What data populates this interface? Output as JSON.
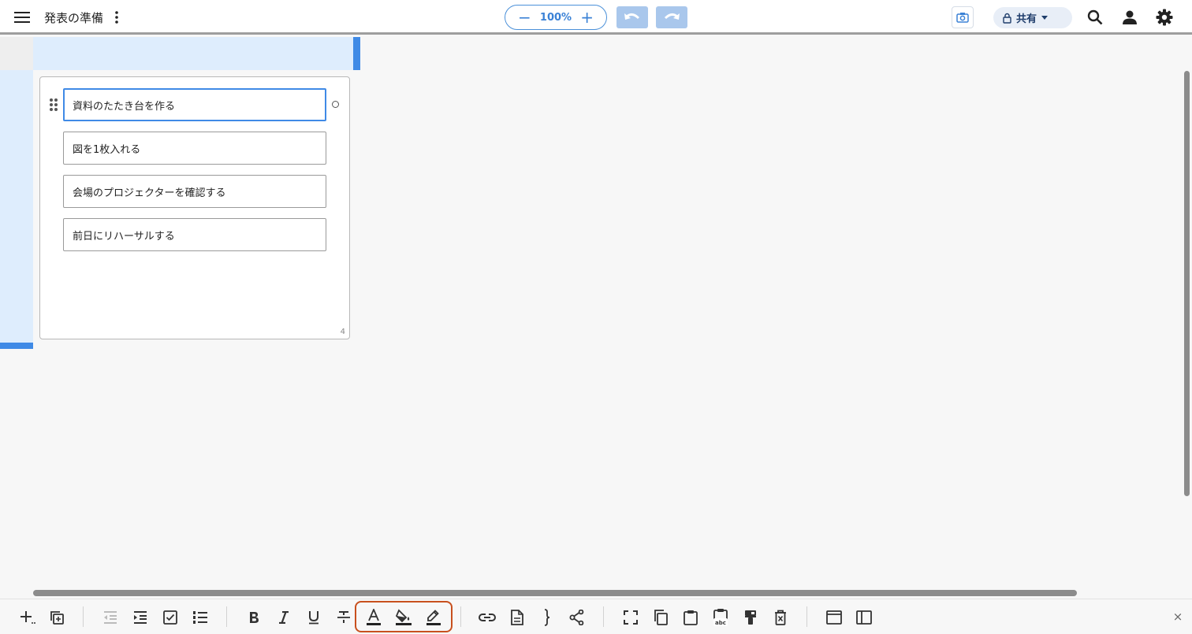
{
  "header": {
    "doc_title": "発表の準備",
    "zoom": {
      "minus": "−",
      "value": "100%",
      "plus": "+"
    },
    "share_label": "共有"
  },
  "card": {
    "items": [
      {
        "text": "資料のたたき台を作る",
        "selected": true
      },
      {
        "text": "図を1枚入れる",
        "selected": false
      },
      {
        "text": "会場のプロジェクターを確認する",
        "selected": false
      },
      {
        "text": "前日にリハーサルする",
        "selected": false
      }
    ],
    "count": "4"
  },
  "toolbar": {
    "tools": [
      "add",
      "duplicate",
      "outdent",
      "indent",
      "checkbox",
      "numbered-list",
      "bold",
      "italic",
      "underline",
      "strikethrough",
      "text-color",
      "fill-color",
      "border-color",
      "link",
      "note",
      "bracket",
      "connector",
      "fullscreen",
      "copy",
      "paste",
      "paste-as-text",
      "format-painter",
      "delete",
      "window",
      "sidebar"
    ],
    "highlighted_group": [
      "text-color",
      "fill-color",
      "border-color"
    ],
    "close_label": "×"
  },
  "colors": {
    "accent": "#3f8ae6",
    "band": "#deedfd",
    "highlight_box": "#c8501e"
  }
}
